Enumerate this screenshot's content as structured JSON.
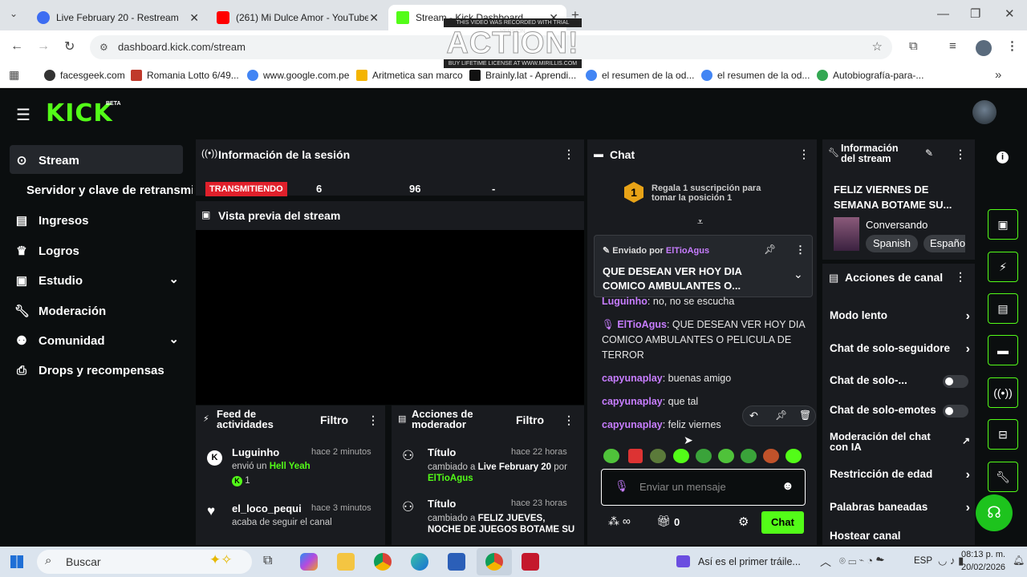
{
  "browser": {
    "tabs": [
      {
        "title": "Live February 20 - Restream",
        "color": "#3d6df2"
      },
      {
        "title": "(261) Mi Dulce Amor - YouTube",
        "color": "#ff0000"
      },
      {
        "title": "Stream - Kick Dashboard",
        "color": "#53fc18"
      }
    ],
    "url": "dashboard.kick.com/stream",
    "bookmarks": [
      "facesgeek.com",
      "Romania Lotto 6/49...",
      "www.google.com.pe",
      "Aritmetica san marco",
      "Brainly.lat - Aprendi...",
      "el resumen de la od...",
      "el resumen de la od...",
      "Autobiografía-para-..."
    ]
  },
  "watermark": {
    "title": "ACTION!",
    "top": "THIS VIDEO WAS RECORDED WITH TRIAL VERSION",
    "bottom": "BUY LIFETIME LICENSE AT WWW.MIRILLIS.COM"
  },
  "kick": {
    "logo": "KICK",
    "beta": "BETA",
    "sidebar": [
      {
        "label": "Stream",
        "icon": "broadcast-icon"
      },
      {
        "label": "Servidor y clave de retransmisión"
      },
      {
        "label": "Ingresos",
        "icon": "chart-icon"
      },
      {
        "label": "Logros",
        "icon": "trophy-icon"
      },
      {
        "label": "Estudio",
        "icon": "studio-icon"
      },
      {
        "label": "Moderación",
        "icon": "wrench-icon"
      },
      {
        "label": "Comunidad",
        "icon": "community-icon"
      },
      {
        "label": "Drops y recompensas",
        "icon": "drops-icon"
      }
    ],
    "session": {
      "title": "Información de la sesión",
      "status": "TRANSMITIENDO",
      "viewers": "6",
      "followers": "96",
      "duration": "-",
      "preview_title": "Vista previa del stream"
    },
    "feed": {
      "title": "Feed de actividades",
      "filter": "Filtro",
      "items": [
        {
          "user": "Luguinho",
          "time": "hace 2 minutos",
          "text": "envió un",
          "highlight": "Hell Yeah",
          "count": "1"
        },
        {
          "user": "el_loco_pequi",
          "time": "hace 3 minutos",
          "text": "acaba de seguir el canal"
        }
      ]
    },
    "mod": {
      "title": "Acciones de moderador",
      "filter": "Filtro",
      "items": [
        {
          "field": "Título",
          "time": "hace 22 horas",
          "text": "cambiado a",
          "value": "Live February 20",
          "by": "por",
          "user": "ElTioAgus"
        },
        {
          "field": "Título",
          "time": "hace 23 horas",
          "text": "cambiado a",
          "value": "FELIZ JUEVES, NOCHE DE JUEGOS BOTAME SU"
        }
      ]
    },
    "chat": {
      "title": "Chat",
      "gift_number": "1",
      "gift_text": "Regala 1 suscripción para tomar la posición 1",
      "pinned_by": "Enviado por",
      "pinned_user": "ElTioAgus",
      "pinned_text": "QUE DESEAN VER HOY DIA COMICO AMBULANTES O...",
      "messages": [
        {
          "user": "Luguinho",
          "text": ": no, no se escucha"
        },
        {
          "user": "ElTioAgus",
          "text": ": QUE DESEAN VER HOY DIA COMICO AMBULANTES O PELICULA DE TERROR"
        },
        {
          "user": "capyunaplay",
          "text": ": buenas amigo"
        },
        {
          "user": "capyunaplay",
          "text": ": que tal"
        },
        {
          "user": "capyunaplay",
          "text": ": feliz viernes"
        }
      ],
      "placeholder": "Enviar un mensaje",
      "points": "0",
      "send": "Chat"
    },
    "stream_info": {
      "title": "Información del stream",
      "stream_title": "FELIZ VIERNES DE SEMANA BOTAME SU...",
      "category": "Conversando",
      "tags": [
        "Spanish",
        "Españo"
      ]
    },
    "channel_actions": {
      "title": "Acciones de canal",
      "items": [
        {
          "label": "Modo lento",
          "type": "chevron"
        },
        {
          "label": "Chat de solo-seguidores",
          "type": "chevron"
        },
        {
          "label": "Chat de solo-...",
          "type": "toggle"
        },
        {
          "label": "Chat de solo-emotes",
          "type": "toggle"
        },
        {
          "label": "Moderación del chat con IA",
          "type": "external"
        },
        {
          "label": "Restricción de edad",
          "type": "chevron"
        },
        {
          "label": "Palabras baneadas",
          "type": "chevron"
        },
        {
          "label": "Hostear canal",
          "type": "none"
        }
      ]
    }
  },
  "taskbar": {
    "search": "Buscar",
    "media": "Así es el primer tráile...",
    "lang": "ESP",
    "time": "08:13 p. m.",
    "date": "20/02/2026"
  }
}
